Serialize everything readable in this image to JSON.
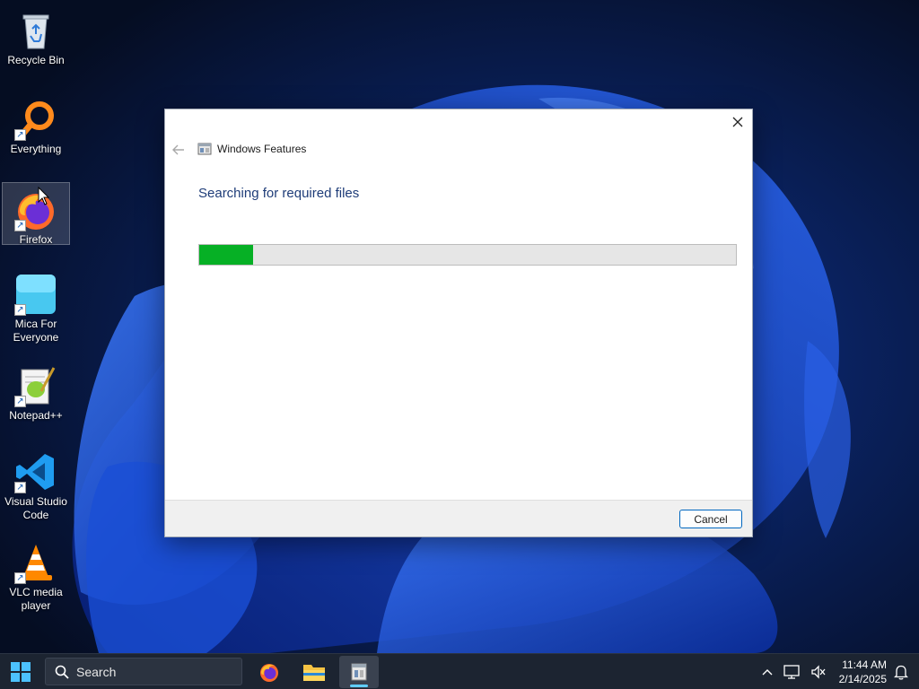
{
  "desktop": {
    "icons": [
      {
        "label": "Recycle Bin",
        "icon": "recycle-bin-icon"
      },
      {
        "label": "Everything",
        "icon": "everything-search-icon"
      },
      {
        "label": "Firefox",
        "icon": "firefox-icon"
      },
      {
        "label": "Mica For Everyone",
        "icon": "mica-icon"
      },
      {
        "label": "Notepad++",
        "icon": "notepad-plus-plus-icon"
      },
      {
        "label": "Visual Studio Code",
        "icon": "vscode-icon"
      },
      {
        "label": "VLC media player",
        "icon": "vlc-icon"
      }
    ]
  },
  "dialog": {
    "title": "Windows Features",
    "heading": "Searching for required files",
    "progress_percent": 10,
    "cancel_label": "Cancel",
    "colors": {
      "progress": "#06b025",
      "heading": "#1e3c78"
    }
  },
  "taskbar": {
    "search_placeholder": "Search",
    "apps": [
      "firefox-icon",
      "file-explorer-icon",
      "windows-features-icon"
    ],
    "active_app": "windows-features-icon",
    "clock": {
      "time": "11:44 AM",
      "date": "2/14/2025"
    }
  }
}
